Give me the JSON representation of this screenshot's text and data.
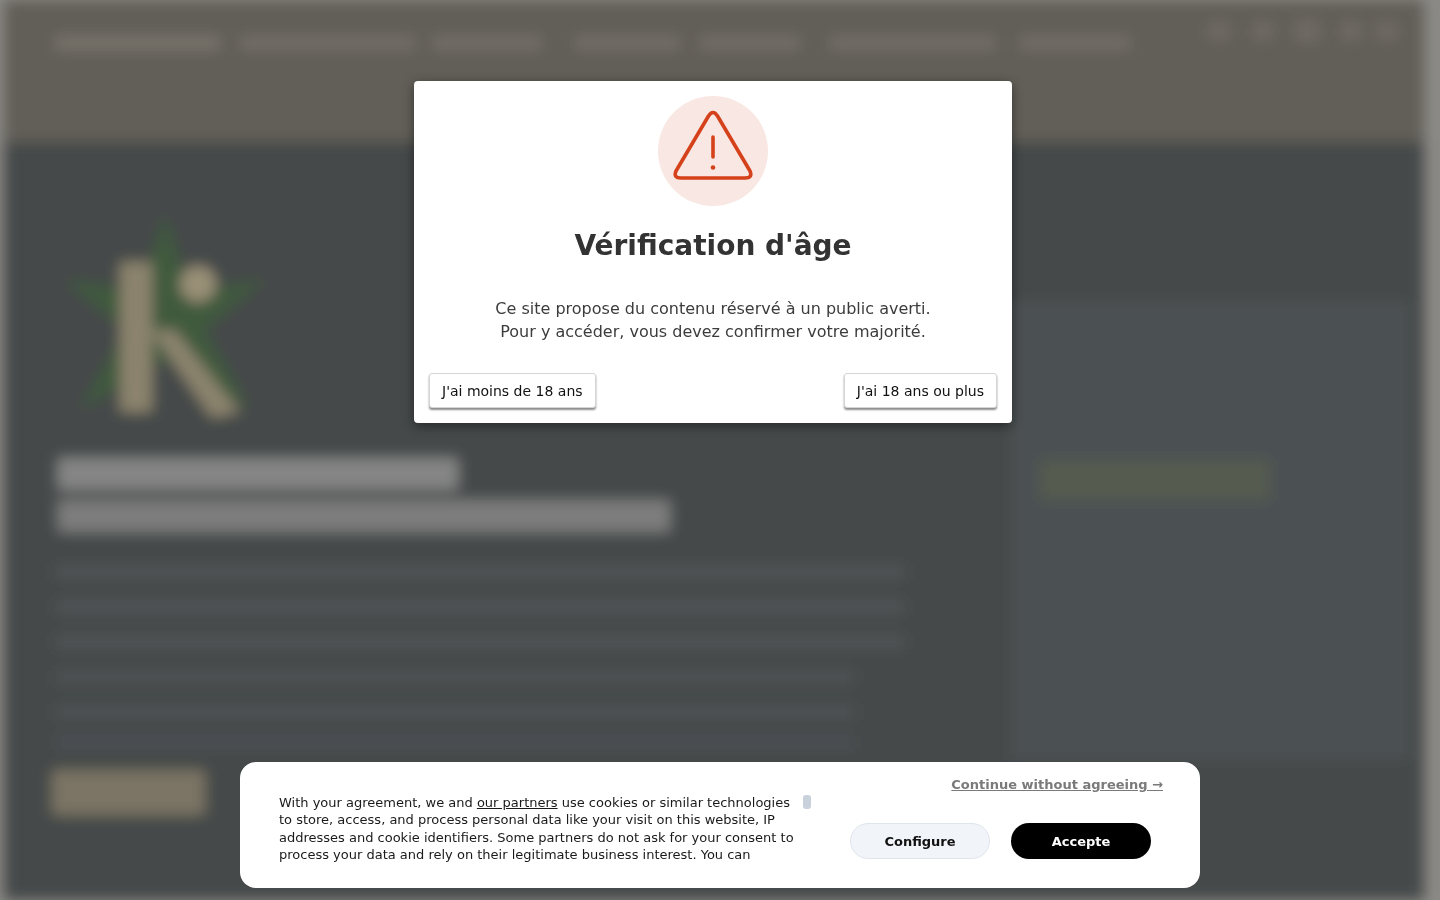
{
  "age_verification": {
    "title": "Vérification d'âge",
    "message_lines": [
      "Ce site propose du contenu réservé à un public averti.",
      "Pour y accéder, vous devez confirmer votre majorité."
    ],
    "buttons": [
      "J'ai moins de 18 ans",
      "J'ai 18 ans ou plus"
    ]
  },
  "cookie_banner": {
    "skip_link": "Continue without agreeing →",
    "notice_before_link": "With your agreement, we and",
    "notice_link": "our partners",
    "notice_after_link": "use cookies or similar technologies to store, access, and process personal data like your visit on this website, IP addresses and cookie identifiers. Some partners do not ask for your consent to process your data and rely on their legitimate business interest. You can",
    "buttons": [
      {
        "label": "Configure",
        "kind": "secondary"
      },
      {
        "label": "Accepte",
        "kind": "primary"
      }
    ]
  }
}
